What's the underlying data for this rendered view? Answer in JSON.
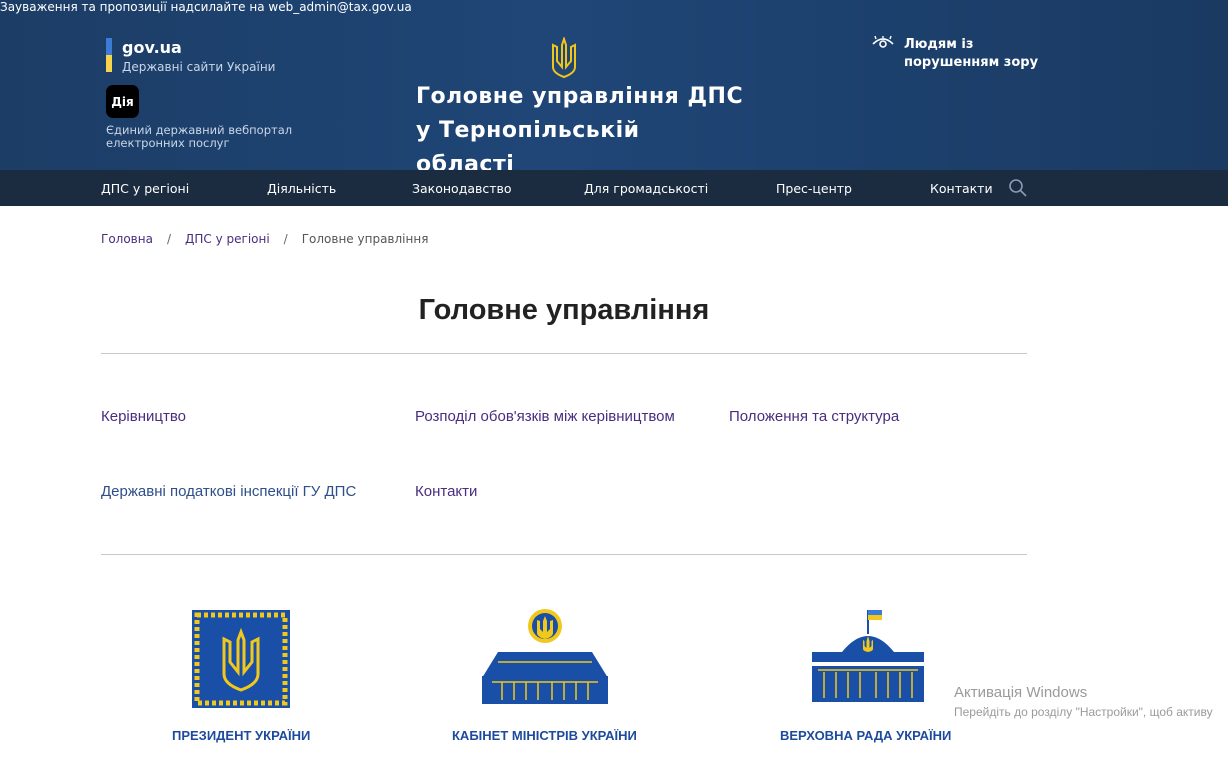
{
  "header": {
    "top_note": "Зауваження та пропозиції надсилайте на web_admin@tax.gov.ua",
    "govua_name": "gov.ua",
    "govua_sub": "Державні сайти України",
    "diia_logo": "Дія",
    "diia_text": "Єдиний державний вебпортал електронних послуг",
    "site_title_line1": "Головне управління ДПС",
    "site_title_line2": "у Тернопільській області",
    "vision_text": "Людям із порушенням зору",
    "colors": {
      "bg": "#1f4677",
      "nav": "#1c2c40",
      "flag_blue": "#3d7bd9",
      "flag_yellow": "#f7d44a"
    }
  },
  "nav": {
    "items": [
      "ДПС у регіоні",
      "Діяльність",
      "Законодавство",
      "Для громадськості",
      "Прес-центр",
      "Контакти"
    ],
    "search_icon": "search-icon"
  },
  "breadcrumb": {
    "home": "Головна",
    "parent": "ДПС у регіоні",
    "current": "Головне управління",
    "separator": "/"
  },
  "main": {
    "title": "Головне управління",
    "links": [
      "Керівництво",
      "Розподіл обов'язків між керівництвом",
      "Положення та структура",
      "Державні податкові інспекції ГУ ДПС",
      "Контакти"
    ]
  },
  "emblems": [
    {
      "label": "ПРЕЗИДЕНТ УКРАЇНИ",
      "icon": "president-standard-icon"
    },
    {
      "label": "КАБІНЕТ МІНІСТРІВ УКРАЇНИ",
      "icon": "cabinet-building-icon"
    },
    {
      "label": "ВЕРХОВНА РАДА УКРАЇНИ",
      "icon": "parliament-building-icon"
    }
  ],
  "watermark": {
    "line1": "Активація Windows",
    "line2": "Перейдіть до розділу \"Настройки\", щоб активу"
  }
}
